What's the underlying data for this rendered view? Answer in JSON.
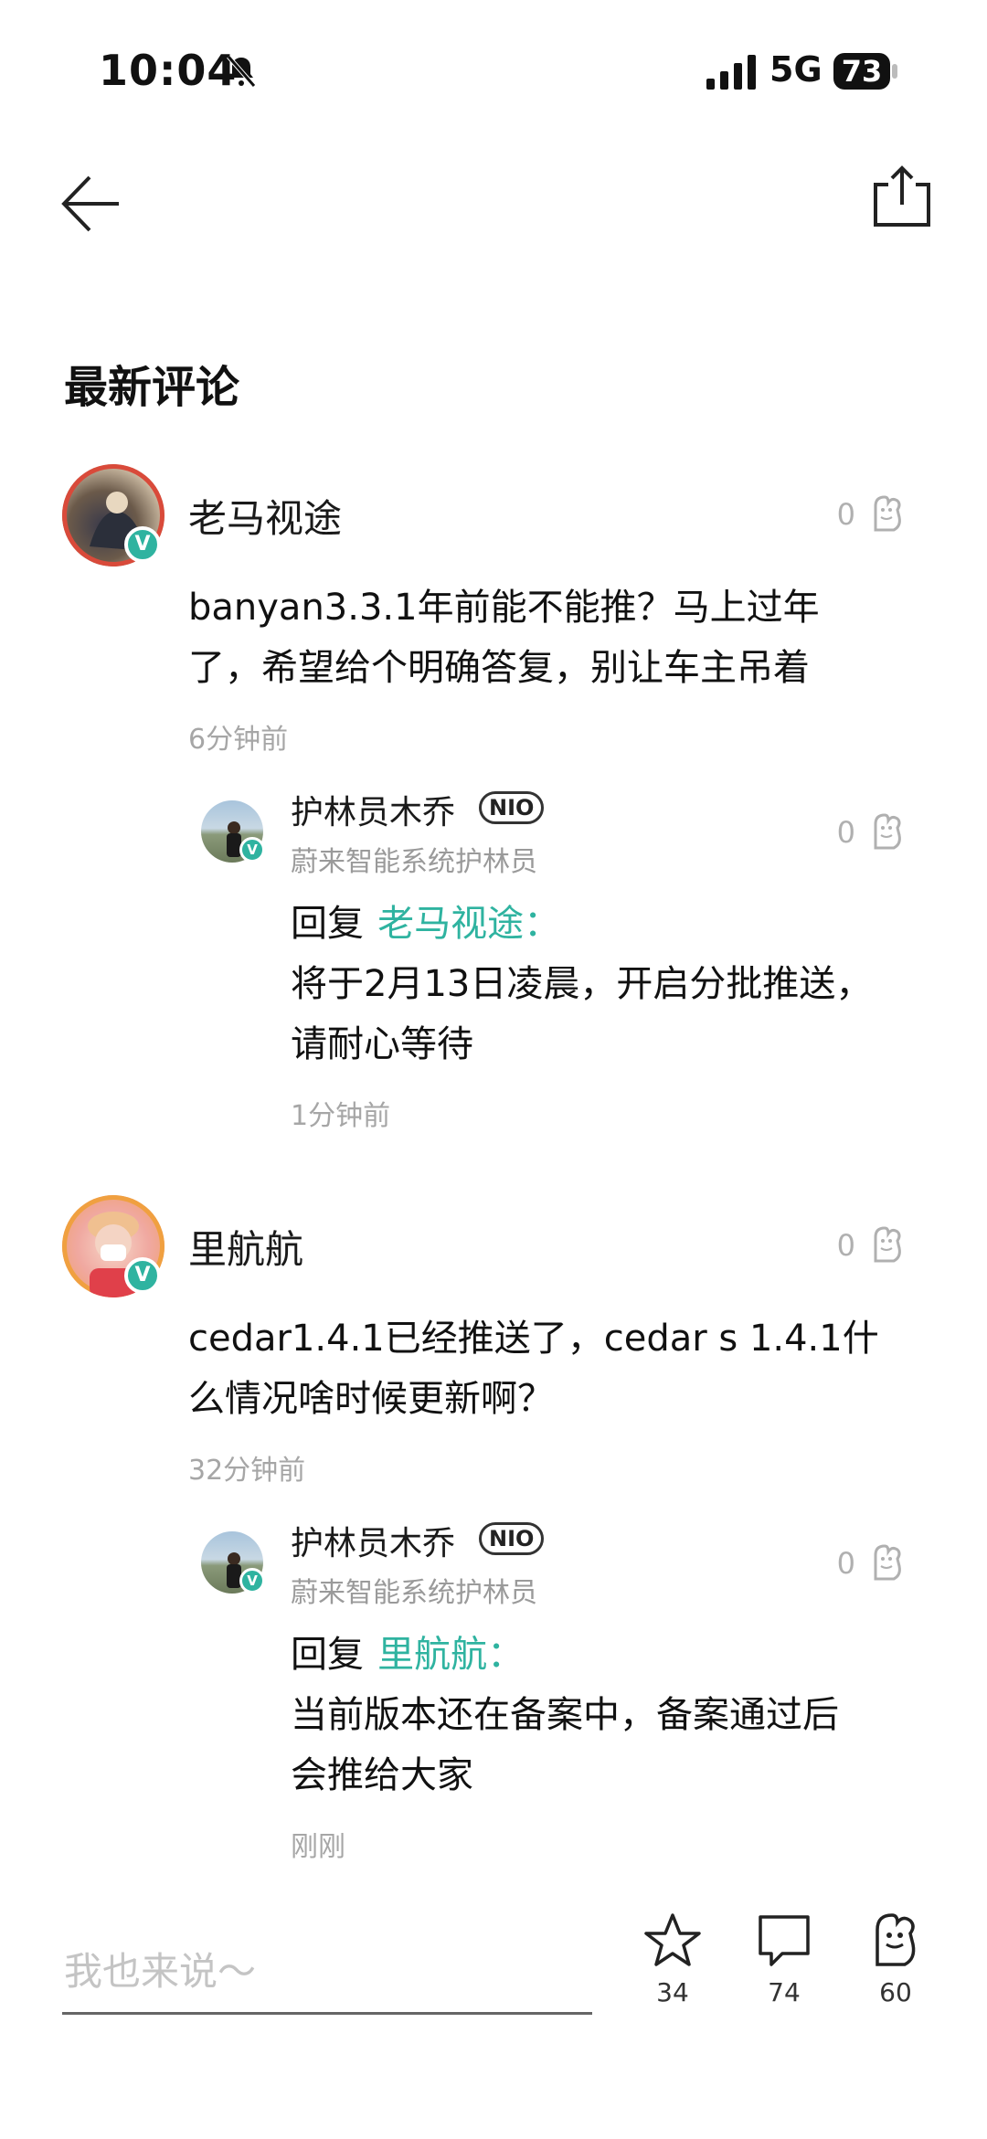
{
  "status": {
    "time": "10:04",
    "network": "5G",
    "battery": "73"
  },
  "header": {
    "title": "最新评论"
  },
  "comments": [
    {
      "user": "老马视途",
      "likes": "0",
      "text_line1": "banyan3.3.1年前能不能推？马上过年",
      "text_line2": "了，希望给个明确答复，别让车主吊着",
      "time": "6分钟前",
      "reply": {
        "user": "护林员木乔",
        "badge": "NIO",
        "subtitle": "蔚来智能系统护林员",
        "likes": "0",
        "prefix": "回复",
        "reply_to": "老马视途：",
        "text_line1": "将于2月13日凌晨，开启分批推送，",
        "text_line2": "请耐心等待",
        "time": "1分钟前"
      }
    },
    {
      "user": "里航航",
      "likes": "0",
      "text_line1": "cedar1.4.1已经推送了，cedar s 1.4.1什",
      "text_line2": "么情况啥时候更新啊？",
      "time": "32分钟前",
      "reply": {
        "user": "护林员木乔",
        "badge": "NIO",
        "subtitle": "蔚来智能系统护林员",
        "likes": "0",
        "prefix": "回复",
        "reply_to": "里航航：",
        "text_line1": "当前版本还在备案中，备案通过后",
        "text_line2": "会推给大家",
        "time": "刚刚"
      }
    }
  ],
  "bottom": {
    "placeholder": "我也来说～",
    "favorites": "34",
    "comments": "74",
    "likes": "60"
  },
  "icons": {
    "back": "back-arrow-icon",
    "share": "share-icon",
    "like": "nio-like-icon",
    "star": "star-icon",
    "comment": "comment-icon"
  },
  "colors": {
    "accent": "#2fb3a0",
    "muted": "#a6a6a6"
  }
}
